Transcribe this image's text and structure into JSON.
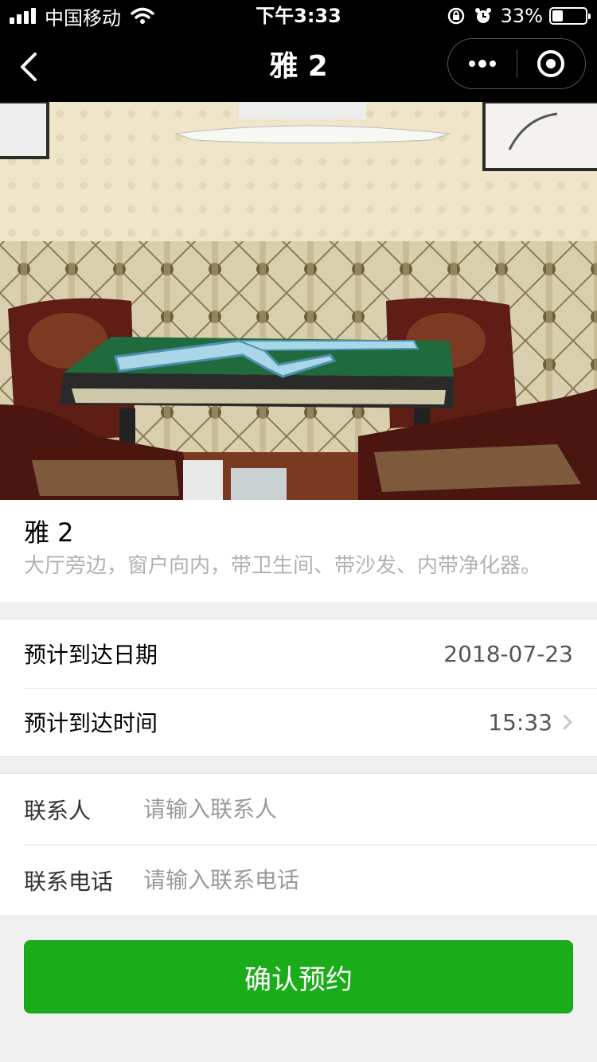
{
  "status_bar": {
    "carrier": "中国移动",
    "time": "下午3:33",
    "battery_text": "33%",
    "battery_level": 0.33
  },
  "nav": {
    "title": "雅 2"
  },
  "room": {
    "name": "雅 2",
    "description": "大厅旁边，窗户向内，带卫生间、带沙发、内带净化器。"
  },
  "arrival": {
    "date_label": "预计到达日期",
    "date_value": "2018-07-23",
    "time_label": "预计到达时间",
    "time_value": "15:33"
  },
  "contact": {
    "name_label": "联系人",
    "name_placeholder": "请输入联系人",
    "phone_label": "联系电话",
    "phone_placeholder": "请输入联系电话"
  },
  "confirm_label": "确认预约",
  "colors": {
    "primary_green": "#1aad19",
    "nav_background": "#000000"
  }
}
